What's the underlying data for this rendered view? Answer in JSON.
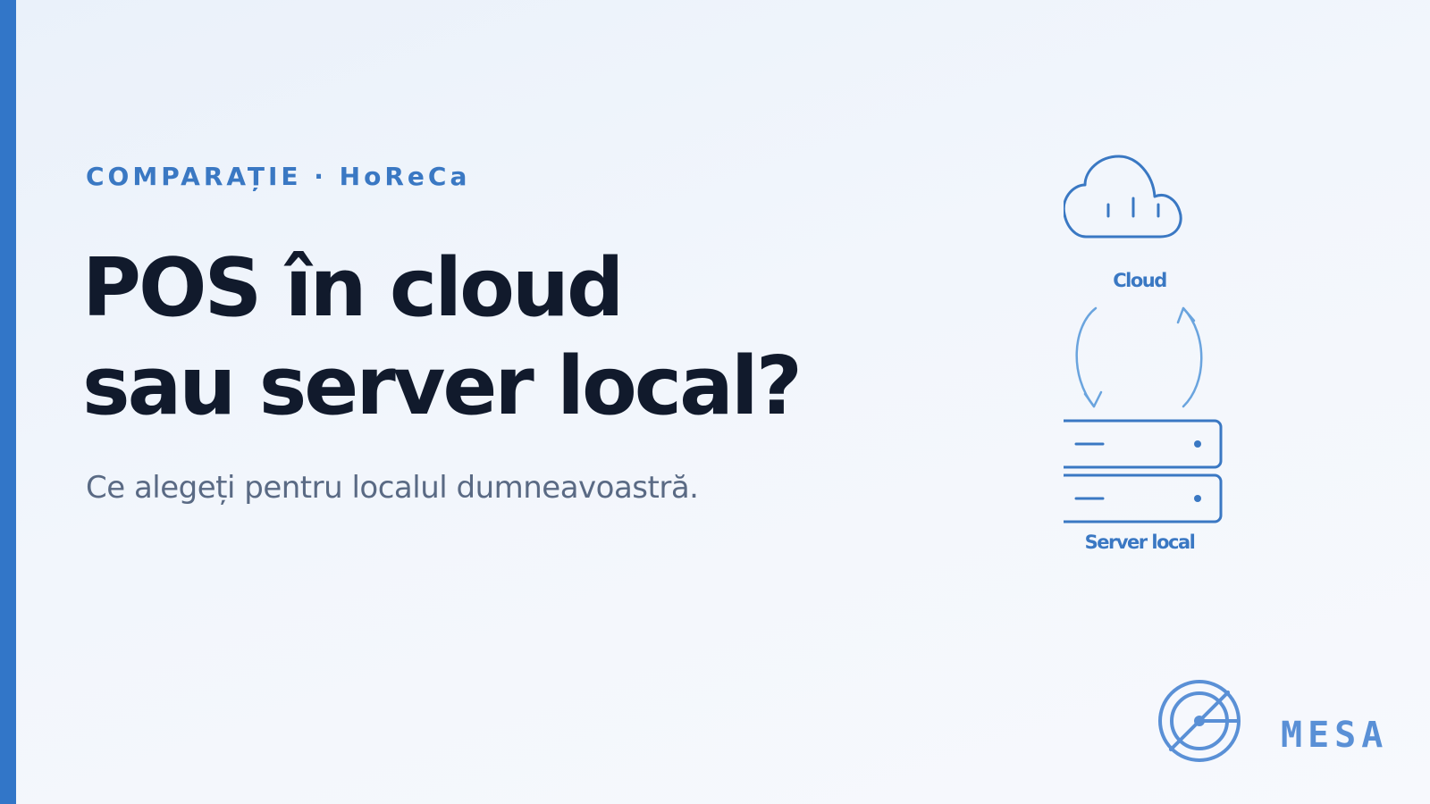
{
  "eyebrow": "COMPARAȚIE · HoReCa",
  "headline": {
    "line1": "POS în cloud",
    "line2": "sau server local?"
  },
  "subtitle": "Ce alegeți pentru localul dumneavoastră.",
  "diagram": {
    "cloud_label": "Cloud",
    "server_label": "Server local",
    "cloud_icon": "cloud-icon",
    "server_icon": "server-icon",
    "sync_icon": "sync-arrows-icon"
  },
  "logo": {
    "text": "MESA",
    "icon": "mesa-logo-icon"
  },
  "colors": {
    "accent": "#3276c8",
    "headline": "#111a2c",
    "subtitle": "#5a6a84",
    "icon_stroke": "#3a78c3",
    "arrow_stroke": "#6aa4de",
    "logo": "#5a90d6"
  }
}
